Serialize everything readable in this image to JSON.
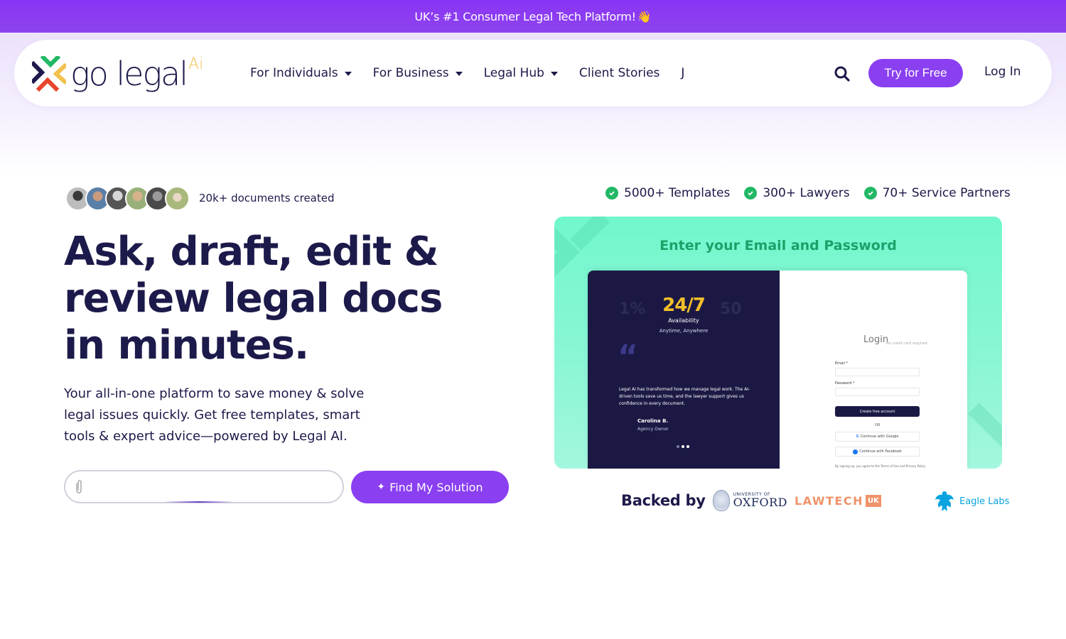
{
  "announcement": {
    "text": "UK’s #1 Consumer Legal Tech Platform!",
    "emoji": "👋"
  },
  "brand": {
    "name": "go legal",
    "suffix": "Ai",
    "colors": {
      "primary": "#8a3ff0",
      "navy": "#1c1a4a",
      "accent_yellow": "#f2c14e",
      "accent_green": "#22b864",
      "accent_red": "#e8452c",
      "mint": "#72f7cd"
    }
  },
  "nav": {
    "items": [
      {
        "label": "For Individuals",
        "has_dropdown": true
      },
      {
        "label": "For Business",
        "has_dropdown": true
      },
      {
        "label": "Legal Hub",
        "has_dropdown": true
      },
      {
        "label": "Client Stories",
        "has_dropdown": false
      },
      {
        "label": "J",
        "has_dropdown": false
      }
    ],
    "search_icon": "search-icon",
    "try_label": "Try for Free",
    "login_label": "Log In"
  },
  "hero": {
    "social_proof": "20k+ documents created",
    "avatar_count": 6,
    "headline": "Ask, draft, edit & review legal docs in minutes.",
    "subtext": "Your all-in-one platform to save money & solve legal issues quickly. Get free templates, smart tools & expert advice—powered by Legal AI.",
    "input_placeholder": "",
    "input_value": "",
    "cta_label": "Find My Solution",
    "cta_icon": "sparkle-icon",
    "attach_icon": "paperclip-icon"
  },
  "features": [
    {
      "label": "5000+ Templates"
    },
    {
      "label": "300+ Lawyers"
    },
    {
      "label": "70+ Service Partners"
    }
  ],
  "showcase": {
    "title": "Enter your Email and Password",
    "stat_value": "24/7",
    "stat_label": "Availability",
    "stat_sub": "Anytime, Anywhere",
    "ghost_left": "1%",
    "ghost_right": "50",
    "quote_mark": "“",
    "quote": "Legal AI has transformed how we manage legal work. The AI-driven tools save us time, and the lawyer support gives us confidence in every document.",
    "author": "Carolina B.",
    "author_role": "Agency Owner",
    "login_title": "Login",
    "login_note": "No credit card required",
    "email_label": "Email *",
    "password_label": "Password *",
    "create_label": "Create free account",
    "or_label": "OR",
    "google_label": "Continue with Google",
    "facebook_label": "Continue with Facebook",
    "terms": "By signing up, you agree to the Terms of Use and Privacy Policy"
  },
  "backed": {
    "label": "Backed by",
    "oxford_small": "UNIVERSITY OF",
    "oxford_big": "OXFORD",
    "lawtech": "LAWTECH",
    "lawtech_uk": "UK",
    "eagle": "Eagle Labs"
  }
}
